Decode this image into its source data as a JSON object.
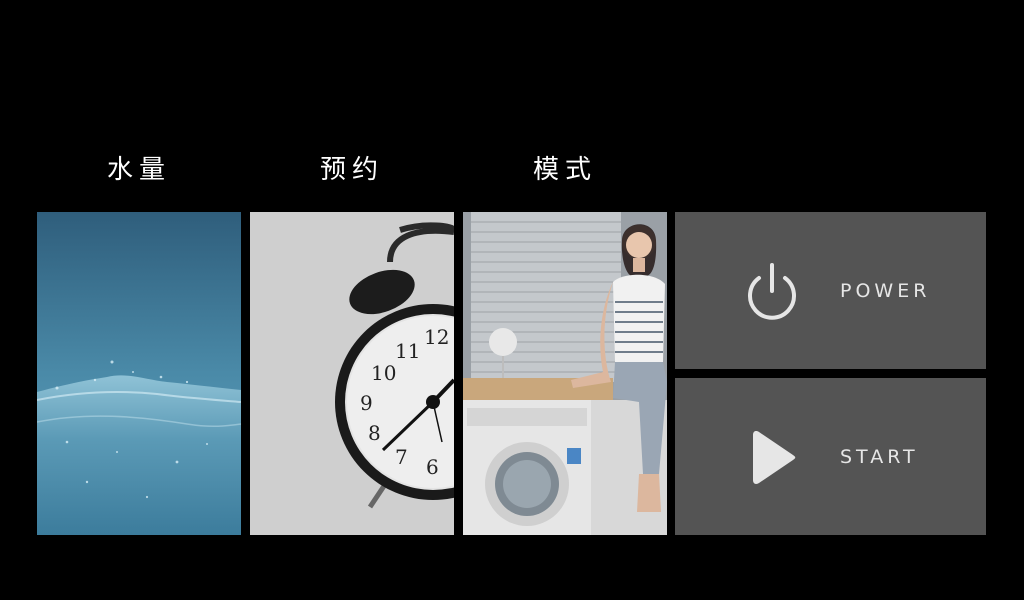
{
  "tiles": [
    {
      "label": "水量",
      "image": "water-wave"
    },
    {
      "label": "预约",
      "image": "alarm-clock"
    },
    {
      "label": "模式",
      "image": "woman-on-washing-machine"
    }
  ],
  "controls": {
    "power_label": "POWER",
    "power_icon": "power-icon",
    "start_label": "START",
    "start_icon": "play-icon"
  },
  "colors": {
    "background": "#000000",
    "control_bg": "#545454",
    "control_text": "#e6e6e6",
    "label_text": "#ffffff"
  }
}
